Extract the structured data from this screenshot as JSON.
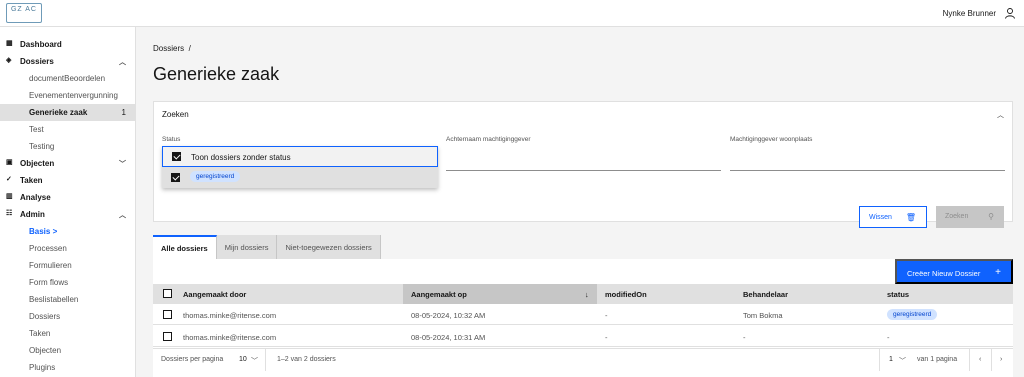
{
  "header": {
    "logo_text": "GZ AC",
    "user_name": "Nynke Brunner"
  },
  "sidebar": {
    "items": [
      {
        "label": "Dashboard",
        "level": "top",
        "icon": "dashboard-icon"
      },
      {
        "label": "Dossiers",
        "level": "top",
        "icon": "folder-icon",
        "chevron": "up"
      },
      {
        "label": "documentBeoordelen",
        "level": "sub"
      },
      {
        "label": "Evenementenvergunning",
        "level": "sub"
      },
      {
        "label": "Generieke zaak",
        "level": "sub",
        "active": true,
        "count": "1"
      },
      {
        "label": "Test",
        "level": "sub"
      },
      {
        "label": "Testing",
        "level": "sub"
      },
      {
        "label": "Objecten",
        "level": "top",
        "icon": "objects-icon",
        "chevron": "down"
      },
      {
        "label": "Taken",
        "level": "top",
        "icon": "tasks-icon"
      },
      {
        "label": "Analyse",
        "level": "top",
        "icon": "analytics-icon"
      },
      {
        "label": "Admin",
        "level": "top",
        "icon": "admin-icon",
        "chevron": "up"
      },
      {
        "label": "Basis >",
        "level": "sub",
        "current": true
      },
      {
        "label": "Processen",
        "level": "sub"
      },
      {
        "label": "Formulieren",
        "level": "sub"
      },
      {
        "label": "Form flows",
        "level": "sub"
      },
      {
        "label": "Beslistabellen",
        "level": "sub"
      },
      {
        "label": "Dossiers",
        "level": "sub"
      },
      {
        "label": "Taken",
        "level": "sub"
      },
      {
        "label": "Objecten",
        "level": "sub"
      },
      {
        "label": "Plugins",
        "level": "sub"
      }
    ]
  },
  "breadcrumb": "Dossiers  /",
  "page_title": "Generieke zaak",
  "search": {
    "title": "Zoeken",
    "status_label": "Status",
    "achternaam_label": "Achternaam machtiginggever",
    "woonplaats_label": "Machtiginggever woonplaats",
    "option_no_status": "Toon dossiers zonder status",
    "option_geregistreerd": "geregistreerd",
    "clear_label": "Wissen",
    "search_label": "Zoeken"
  },
  "tabs": [
    "Alle dossiers",
    "Mijn dossiers",
    "Niet-toegewezen dossiers"
  ],
  "create_button": "Creëer Nieuw Dossier",
  "table": {
    "headers": [
      "Aangemaakt door",
      "Aangemaakt op",
      "modifiedOn",
      "Behandelaar",
      "status"
    ],
    "rows": [
      [
        "thomas.minke@ritense.com",
        "08-05-2024, 10:32 AM",
        "-",
        "Tom Bokma",
        "geregistreerd"
      ],
      [
        "thomas.minke@ritense.com",
        "08-05-2024, 10:31 AM",
        "-",
        "-",
        "-"
      ]
    ]
  },
  "pagination": {
    "per_page_label": "Dossiers per pagina",
    "per_page_value": "10",
    "range_label": "1–2 van 2 dossiers",
    "page_value": "1",
    "page_of_label": "van 1 pagina"
  },
  "colors": {
    "primary": "#0f62fe",
    "tag_bg": "#d0e2ff",
    "tag_text": "#0043ce"
  }
}
